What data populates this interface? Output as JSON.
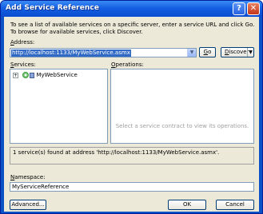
{
  "window": {
    "title": "Add Service Reference",
    "help_glyph": "?",
    "close_glyph": "✕"
  },
  "description": "To see a list of available services on a specific server, enter a service URL and click Go. To browse for available services, click Discover.",
  "address": {
    "label_accel": "A",
    "label_rest": "ddress:",
    "value": "http://localhost:1133/MyWebService.asmx"
  },
  "buttons": {
    "go_accel": "G",
    "go_rest": "o",
    "discover_accel": "D",
    "discover_rest": "iscover",
    "advanced": "Advanced...",
    "ok": "OK",
    "cancel": "Cancel"
  },
  "services": {
    "label_accel": "S",
    "label_rest": "ervices:",
    "items": [
      {
        "name": "MyWebService",
        "expander": "+"
      }
    ]
  },
  "operations": {
    "label_accel": "O",
    "label_rest": "perations:",
    "hint": "Select a service contract to view its operations."
  },
  "status": "1 service(s) found at address 'http://localhost:1133/MyWebService.asmx'.",
  "namespace": {
    "label_accel": "N",
    "label_rest": "amespace:",
    "value": "MyServiceReference"
  },
  "colors": {
    "title_bar": "#1560e2",
    "dialog_bg": "#ece9d8",
    "selection": "#316ac5"
  }
}
